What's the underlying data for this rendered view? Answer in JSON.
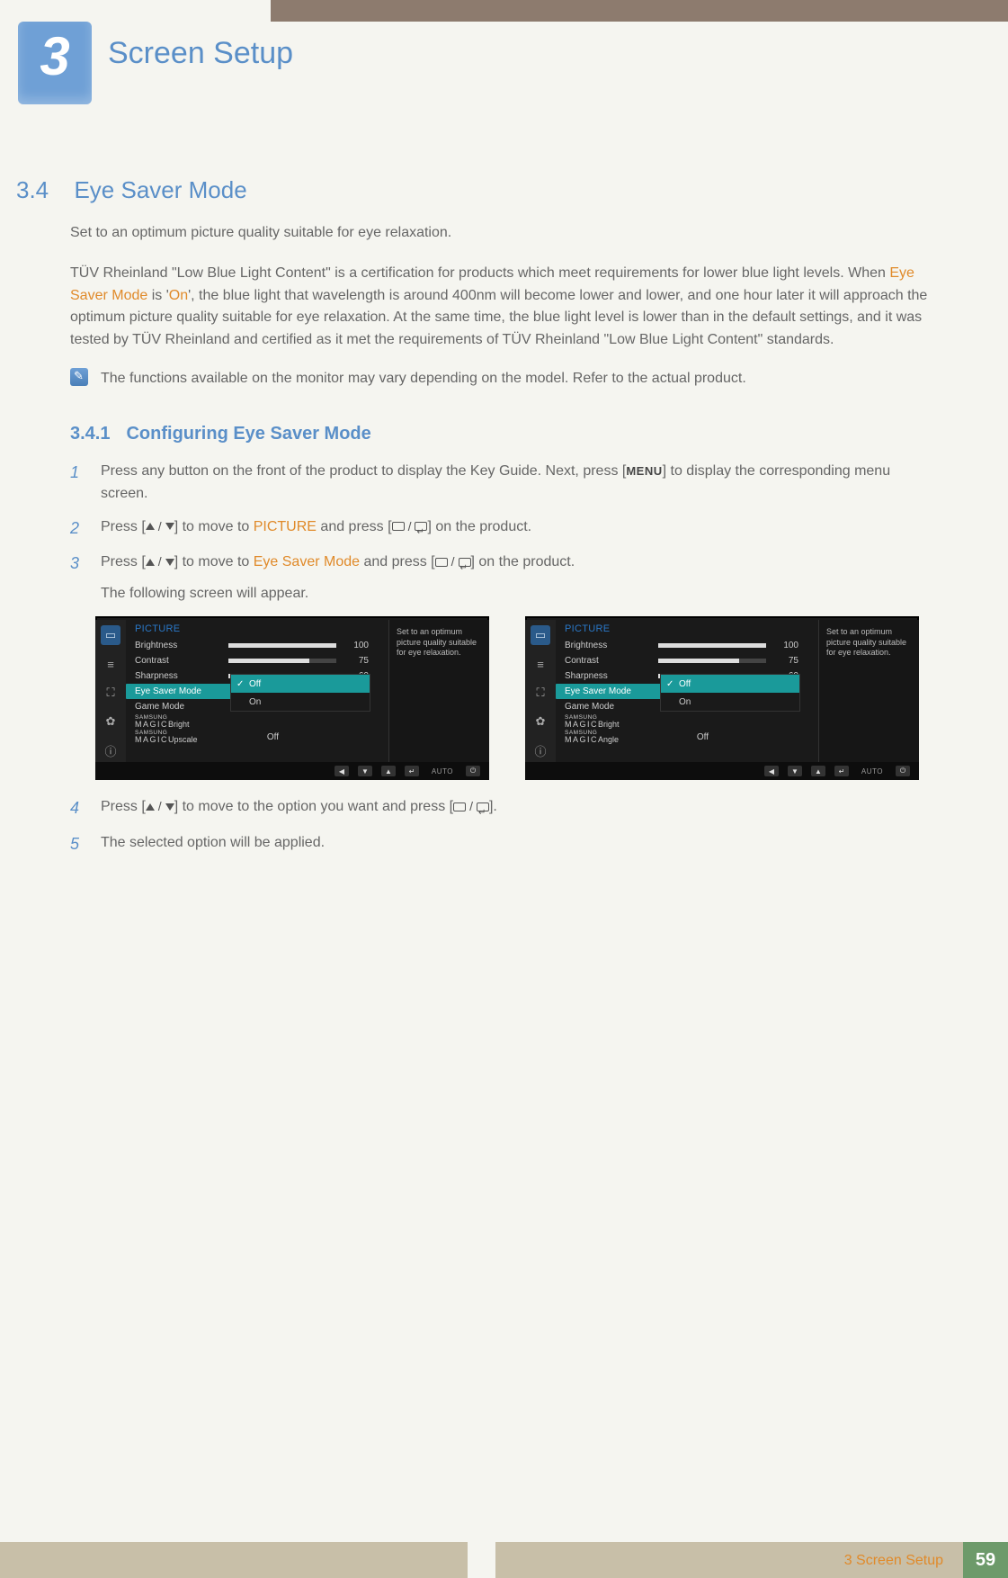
{
  "chapter": {
    "number": "3",
    "title": "Screen Setup"
  },
  "section": {
    "number": "3.4",
    "title": "Eye Saver Mode",
    "intro": "Set to an optimum picture quality suitable for eye relaxation.",
    "body_pre": "TÜV Rheinland \"Low Blue Light Content\" is a certification for products which meet requirements for lower blue light levels. When ",
    "body_mode": "Eye Saver Mode",
    "body_mid": " is '",
    "body_on": "On",
    "body_post": "', the blue light that wavelength is around 400nm will become lower and lower, and one hour later it will approach the optimum picture quality suitable for eye relaxation. At the same time, the blue light level is lower than in the default settings, and it was tested by TÜV Rheinland and certified as it met the requirements of TÜV Rheinland \"Low Blue Light Content\" standards.",
    "note": "The functions available on the monitor may vary depending on the model. Refer to the actual product."
  },
  "subsection": {
    "number": "3.4.1",
    "title": "Configuring Eye Saver Mode"
  },
  "steps": {
    "s1a": "Press any button on the front of the product to display the Key Guide. Next, press [",
    "s1_menu": "MENU",
    "s1b": "] to display the corresponding menu screen.",
    "s2a": "Press [",
    "s2b": "] to move to ",
    "s2_pic": "PICTURE",
    "s2c": " and press [",
    "s2d": "] on the product.",
    "s3a": "Press [",
    "s3b": "] to move to ",
    "s3_mode": "Eye Saver Mode",
    "s3c": " and press [",
    "s3d": "] on the product.",
    "s3e": "The following screen will appear.",
    "s4a": "Press [",
    "s4b": "] to move to the option you want and press [",
    "s4c": "].",
    "s5": "The selected option will be applied."
  },
  "osd": {
    "title": "PICTURE",
    "brightness": {
      "label": "Brightness",
      "value": "100",
      "pct": 100
    },
    "contrast": {
      "label": "Contrast",
      "value": "75",
      "pct": 75
    },
    "sharpness": {
      "label": "Sharpness",
      "value": "60",
      "pct": 60
    },
    "eyesaver": "Eye Saver Mode",
    "gamemode": "Game Mode",
    "magic_samsung": "SAMSUNG",
    "magic_bright": "Bright",
    "magic_upscale": "Upscale",
    "magic_angle": "Angle",
    "magic_word": "MAGIC",
    "popup": {
      "off": "Off",
      "on": "On"
    },
    "off_value": "Off",
    "tip": "Set to an optimum picture quality suitable for eye relaxation.",
    "auto": "AUTO"
  },
  "footer": {
    "label": "3 Screen Setup",
    "page": "59"
  }
}
